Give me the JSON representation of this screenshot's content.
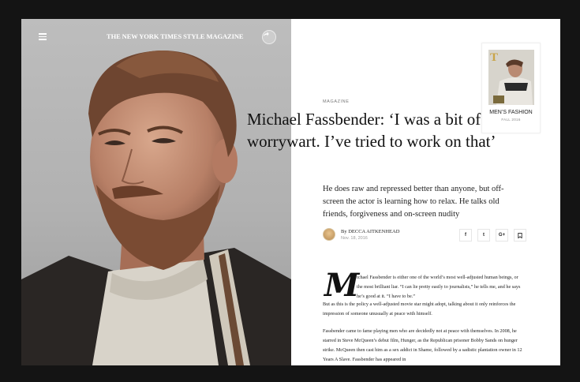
{
  "masthead": "THE NEW YORK TIMES STYLE MAGAZINE",
  "icons": {
    "menu": "hamburger-menu-icon",
    "share": "share-arrow-icon",
    "bookmark": "bookmark-icon"
  },
  "article": {
    "kicker": "MAGAZINE",
    "headline": "Michael Fassbender: ‘I was a bit of a worrywart. I’ve tried to work on that’",
    "dek": "He does raw and repressed better than anyone, but off-screen the actor is learning how to relax. He talks old friends, forgiveness and on-screen nudity",
    "author": "By DECCA AITKENHEAD",
    "date": "Nov. 18, 2016",
    "dropcap": "M",
    "p1_first": "ichael Fassbender is either one of the world’s most well-adjusted human beings, or the most brilliant liar. “I can lie pretty easily to journalists,” he tells me, and he says he’s good at it. “I have to be.”",
    "p1_rest": "But as this is the policy a well-adjusted movie star might adopt, talking about it only reinforces the impression of someone unusually at peace with himself.",
    "p2": "Fassbender came to fame playing men who are decidedly not at peace with themselves. In 2008, he starred in Steve McQueen’s debut film, Hunger, as the Republican prisoner Bobby Sands on hunger strike. McQueen then cast him as a sex addict in Shame, followed by a sadistic plantation owner in 12 Years A Slave. Fassbender has appeared in"
  },
  "social": {
    "facebook": "f",
    "twitter": "t",
    "google": "G+"
  },
  "cover": {
    "title": "MEN’S FASHION",
    "season": "FALL 2016",
    "letter": "T"
  },
  "colors": {
    "background": "#141414",
    "page": "#ffffff",
    "text": "#111111"
  }
}
